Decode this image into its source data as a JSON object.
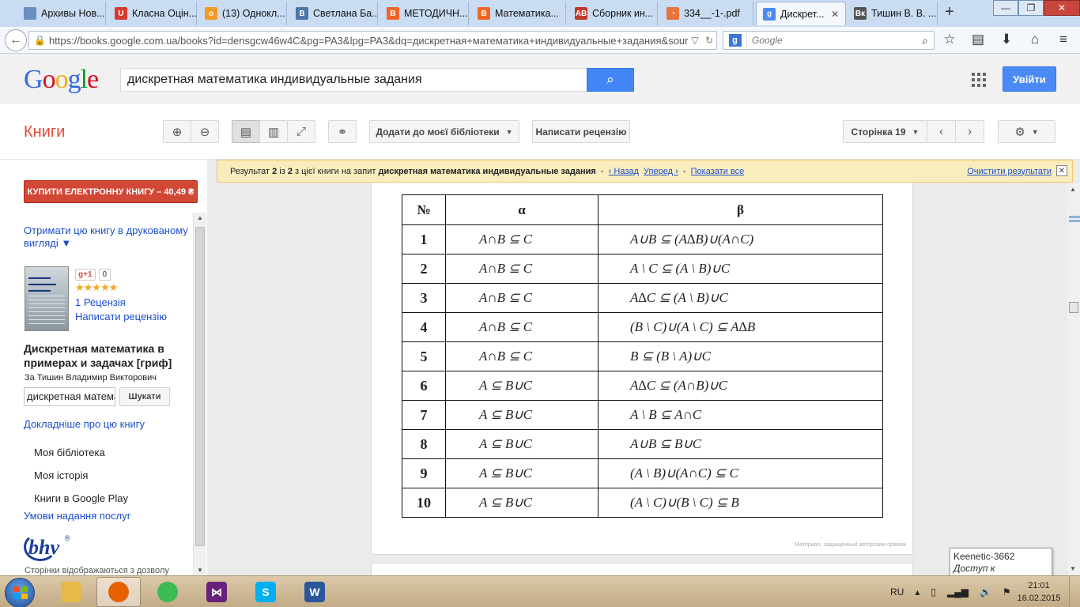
{
  "browser": {
    "tabs": [
      {
        "label": "Архивы Нов...",
        "icon_color": "#6a8fc0",
        "icon_text": ""
      },
      {
        "label": "Класна Оцін...",
        "icon_color": "#d63a2f",
        "icon_text": "U"
      },
      {
        "label": "(13) Однокл...",
        "icon_color": "#f59a23",
        "icon_text": "о"
      },
      {
        "label": "Светлана Ба...",
        "icon_color": "#4a76a8",
        "icon_text": "В"
      },
      {
        "label": "МЕТОДИЧН...",
        "icon_color": "#f26522",
        "icon_text": "B"
      },
      {
        "label": "Математика...",
        "icon_color": "#f26522",
        "icon_text": "B"
      },
      {
        "label": "Сборник ин...",
        "icon_color": "#c0392b",
        "icon_text": "AB"
      },
      {
        "label": "334__-1-.pdf",
        "icon_color": "#e8743b",
        "icon_text": "◔"
      },
      {
        "label": "Дискрет...",
        "icon_color": "#4a8af4",
        "icon_text": "g"
      },
      {
        "label": "Тишин В. В. ...",
        "icon_color": "#555555",
        "icon_text": "Вк"
      }
    ],
    "new_tab": "+",
    "url": "https://books.google.com.ua/books?id=densgcw46w4C&pg=PA3&lpg=PA3&dq=дискретная+математика+индивидуальные+задания&source=bl&ot",
    "search_engine_label": "g",
    "search_placeholder": "Google"
  },
  "google_header": {
    "logo": [
      "G",
      "o",
      "o",
      "g",
      "l",
      "e"
    ],
    "query": "дискретная математика индивидуальные задания",
    "signin": "Увійти"
  },
  "toolbar": {
    "section": "Книги",
    "add_library": "Додати до моєї бібліотеки",
    "write_review": "Написати рецензію",
    "page_select": "Сторінка 19"
  },
  "notice": {
    "prefix": "Результат",
    "result": "2",
    "of_word": "із",
    "total": "2",
    "middle": "з цієї книги на запит",
    "query": "дискретная математика индивидуальные задания",
    "back": "‹ Назад",
    "forward": "Уперед ›",
    "show_all": "Показати все",
    "clear": "Очистити результати"
  },
  "sidebar": {
    "buy": "КУПИТИ ЕЛЕКТРОННУ КНИГУ – 40,49 ₴",
    "print_link": "Отримати цю книгу в друкованому вигляді ▼",
    "gplus": "g+1",
    "gplus_count": "0",
    "stars": "★★★★★",
    "reviews": "1 Рецензія",
    "write_review": "Написати рецензію",
    "title": "Дискретная математика в примерах и задачах [гриф]",
    "author": "За Тишин Владимир Викторович",
    "inbook_query": "дискретная математика",
    "inbook_button": "Шукати",
    "more": "Докладніше про цю книгу",
    "menu": [
      "Моя бібліотека",
      "Моя історія",
      "Книги в Google Play"
    ],
    "terms": "Умови надання послуг",
    "publisher_logo": "bhv",
    "footer_note": "Сторінки відображаються з дозволу"
  },
  "page": {
    "headers": [
      "№",
      "α",
      "β"
    ],
    "rows": [
      {
        "n": "1",
        "alpha": "A∩B ⊆ C",
        "beta": "A∪B ⊆ (A∆B)∪(A∩C)"
      },
      {
        "n": "2",
        "alpha": "A∩B ⊆ C",
        "beta": "A \\ C ⊆ (A \\ B)∪C"
      },
      {
        "n": "3",
        "alpha": "A∩B ⊆ C",
        "beta": "A∆C ⊆ (A \\ B)∪C"
      },
      {
        "n": "4",
        "alpha": "A∩B ⊆ C",
        "beta": "(B \\ C)∪(A \\ C) ⊆ A∆B"
      },
      {
        "n": "5",
        "alpha": "A∩B ⊆ C",
        "beta": "B ⊆ (B \\ A)∪C"
      },
      {
        "n": "6",
        "alpha": "A ⊆ B∪C",
        "beta": "A∆C ⊆ (A∩B)∪C"
      },
      {
        "n": "7",
        "alpha": "A ⊆ B∪C",
        "beta": "A \\ B ⊆ A∩C"
      },
      {
        "n": "8",
        "alpha": "A ⊆ B∪C",
        "beta": "A∪B ⊆ B∪C"
      },
      {
        "n": "9",
        "alpha": "A ⊆ B∪C",
        "beta": "(A \\ B)∪(A∩C) ⊆ C"
      },
      {
        "n": "10",
        "alpha": "A ⊆ B∪C",
        "beta": "(A \\ C)∪(B \\ C) ⊆ B"
      }
    ],
    "copyright": "Материал, защищенный авторским правом"
  },
  "tooltip": {
    "line1": "Keenetic-3662",
    "line2": "Доступ к Интернету"
  },
  "taskbar": {
    "apps": [
      {
        "name": "explorer",
        "icon_color": "#e8b84a",
        "icon_text": ""
      },
      {
        "name": "firefox",
        "icon_color": "#e66000",
        "icon_text": ""
      },
      {
        "name": "chrome",
        "icon_color": "#3cba54",
        "icon_text": ""
      },
      {
        "name": "visual-studio",
        "icon_color": "#68217a",
        "icon_text": "⋈"
      },
      {
        "name": "skype",
        "icon_color": "#00aff0",
        "icon_text": "S"
      },
      {
        "name": "word",
        "icon_color": "#2b579a",
        "icon_text": "W"
      }
    ],
    "lang": "RU",
    "time": "21:01",
    "date": "16.02.2015"
  }
}
